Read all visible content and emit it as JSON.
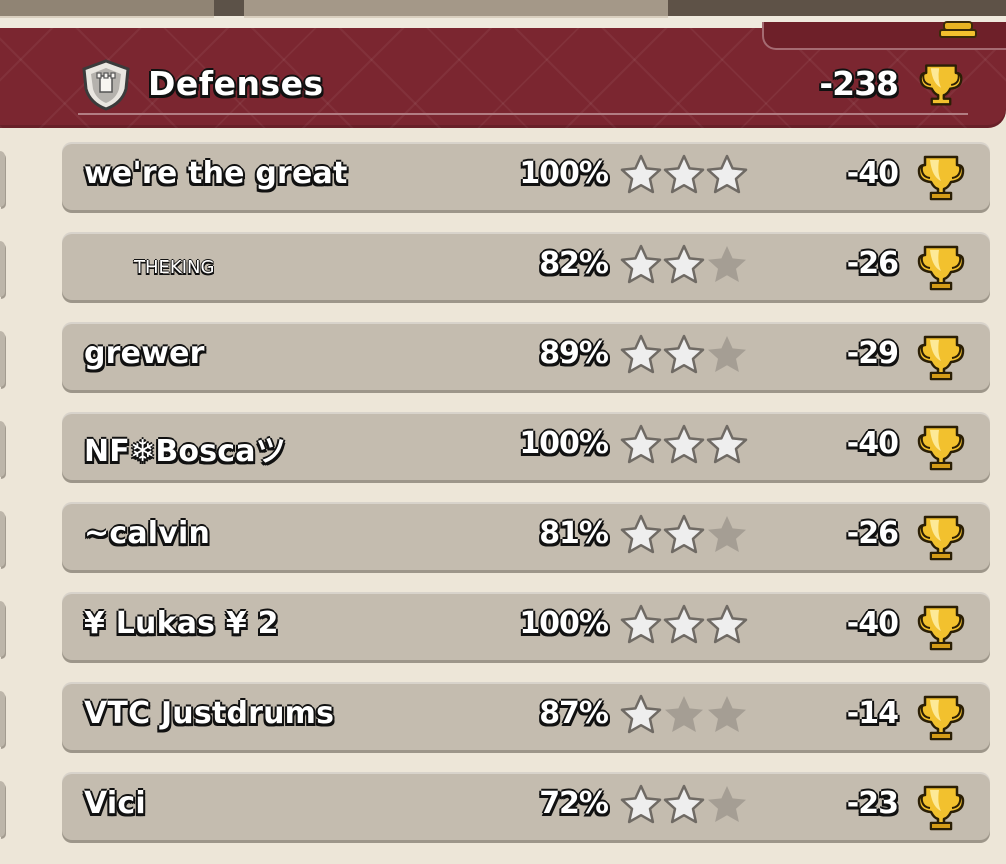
{
  "header": {
    "title": "Defenses",
    "total_trophies": "-238"
  },
  "colors": {
    "banner": "#7b2630",
    "row_bg": "#c4bcaf",
    "page_bg": "#ede6d8",
    "star_earned": "#eeeeee",
    "star_empty": "#a59e94",
    "trophy_gold": "#f2c12e"
  },
  "icons": {
    "header": "shield-icon",
    "trophy": "trophy-icon",
    "star": "star-icon"
  },
  "defenses": [
    {
      "name": "we're the great",
      "percent": "100%",
      "stars": 3,
      "trophies": "-40"
    },
    {
      "name": "THEKING",
      "percent": "82%",
      "stars": 2,
      "trophies": "-26"
    },
    {
      "name": "grewer",
      "percent": "89%",
      "stars": 2,
      "trophies": "-29"
    },
    {
      "name": "NF❄Boscaツ",
      "percent": "100%",
      "stars": 3,
      "trophies": "-40"
    },
    {
      "name": "~calvin",
      "percent": "81%",
      "stars": 2,
      "trophies": "-26"
    },
    {
      "name": "¥ Lukas ¥ 2",
      "percent": "100%",
      "stars": 3,
      "trophies": "-40"
    },
    {
      "name": "VTC Justdrums",
      "percent": "87%",
      "stars": 1,
      "trophies": "-14"
    },
    {
      "name": "Vici",
      "percent": "72%",
      "stars": 2,
      "trophies": "-23"
    }
  ]
}
